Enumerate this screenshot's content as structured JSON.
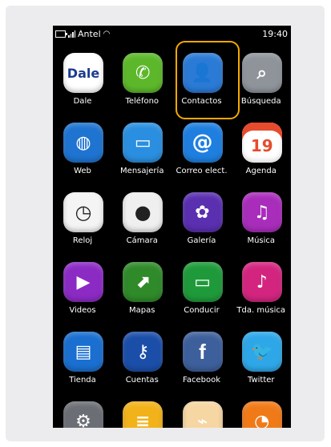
{
  "status_bar": {
    "carrier": "Antel",
    "time": "19:40"
  },
  "apps": [
    {
      "label": "Dale",
      "icon": "dale-icon",
      "color": "#ffffff"
    },
    {
      "label": "Teléfono",
      "icon": "phone-icon",
      "color": "#5cb82a"
    },
    {
      "label": "Contactos",
      "icon": "contacts-icon",
      "color": "#2a7ad6"
    },
    {
      "label": "Búsqueda",
      "icon": "search-icon",
      "color": "#8f949b"
    },
    {
      "label": "Web",
      "icon": "globe-icon",
      "color": "#1e74d0"
    },
    {
      "label": "Mensajería",
      "icon": "message-icon",
      "color": "#2a8fe0"
    },
    {
      "label": "Correo elect.",
      "icon": "email-icon",
      "color": "#1e7fe0"
    },
    {
      "label": "Agenda",
      "icon": "calendar-icon",
      "color": "#ffffff",
      "text": "19"
    },
    {
      "label": "Reloj",
      "icon": "clock-icon",
      "color": "#f4f4f4"
    },
    {
      "label": "Cámara",
      "icon": "camera-icon",
      "color": "#efefef"
    },
    {
      "label": "Galería",
      "icon": "gallery-icon",
      "color": "#5a2fb0"
    },
    {
      "label": "Música",
      "icon": "music-icon",
      "color": "#a92dbb"
    },
    {
      "label": "Videos",
      "icon": "video-icon",
      "color": "#8c2bc4"
    },
    {
      "label": "Mapas",
      "icon": "maps-icon",
      "color": "#2f8a2a"
    },
    {
      "label": "Conducir",
      "icon": "drive-icon",
      "color": "#1f9a3a"
    },
    {
      "label": "Tda. música",
      "icon": "music-store-icon",
      "color": "#d3257f"
    },
    {
      "label": "Tienda",
      "icon": "store-icon",
      "color": "#1a6fd0"
    },
    {
      "label": "Cuentas",
      "icon": "accounts-icon",
      "color": "#1b4ea8"
    },
    {
      "label": "Facebook",
      "icon": "facebook-icon",
      "color": "#3d5f9b"
    },
    {
      "label": "Twitter",
      "icon": "twitter-icon",
      "color": "#2ea7e8"
    },
    {
      "label": "",
      "icon": "settings-icon",
      "color": "#6b6f75"
    },
    {
      "label": "",
      "icon": "notes-icon",
      "color": "#f2b21a"
    },
    {
      "label": "",
      "icon": "attachment-icon",
      "color": "#f6d6a2"
    },
    {
      "label": "",
      "icon": "rss-icon",
      "color": "#f07a18"
    }
  ]
}
